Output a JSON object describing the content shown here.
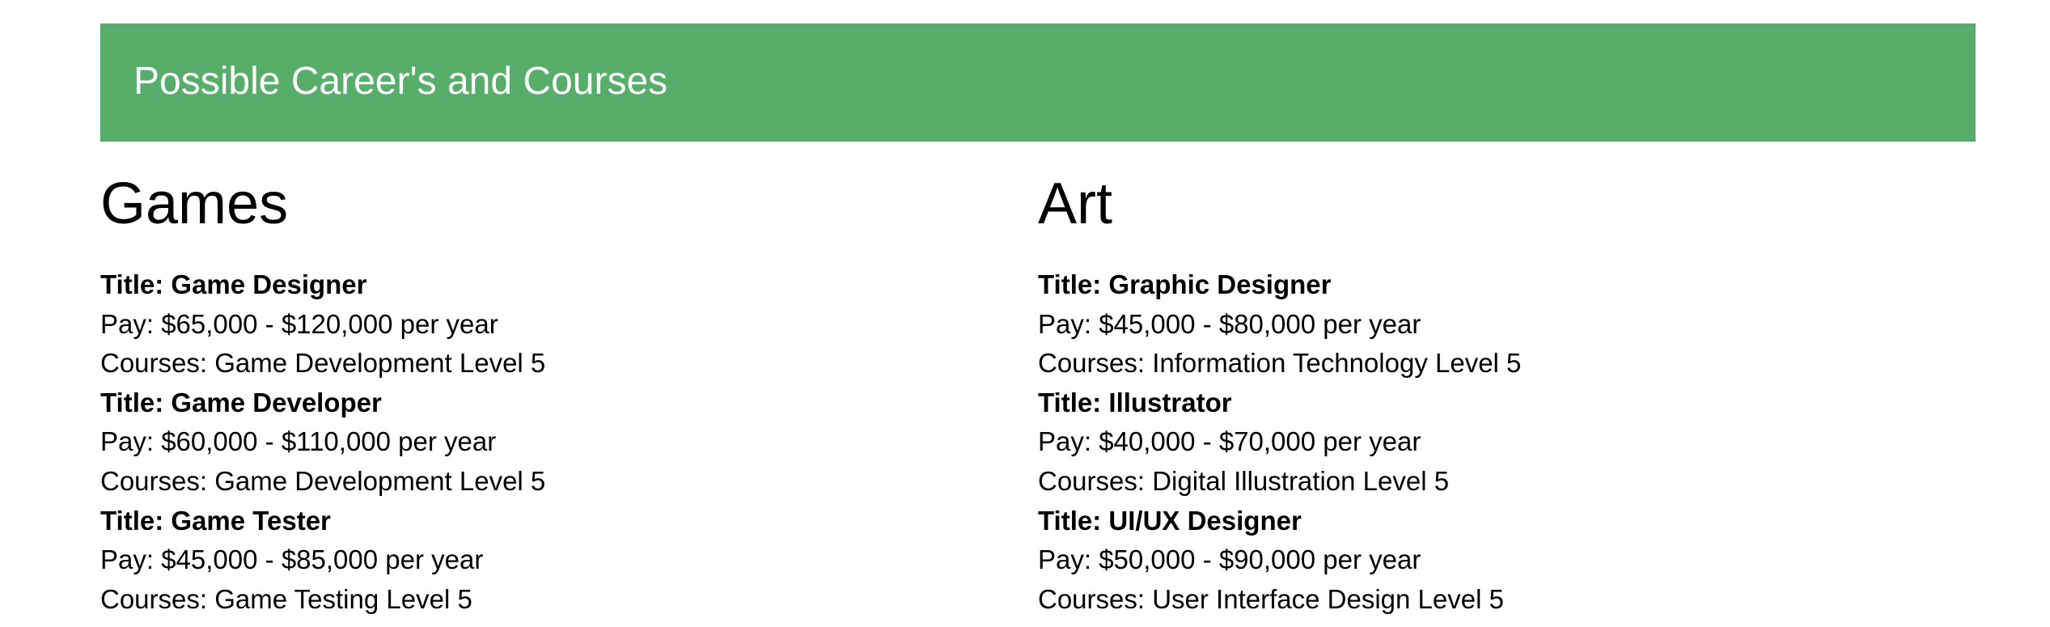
{
  "banner": {
    "title": "Possible Career's and Courses",
    "color": "#56ae6a"
  },
  "columns": [
    {
      "heading": "Games",
      "jobs": [
        {
          "title": "Title: Game Designer",
          "pay": "Pay: $65,000 - $120,000 per year",
          "courses": "Courses: Game Development Level 5"
        },
        {
          "title": "Title: Game Developer",
          "pay": "Pay: $60,000 - $110,000 per year",
          "courses": "Courses: Game Development Level 5"
        },
        {
          "title": "Title: Game Tester",
          "pay": "Pay: $45,000 - $85,000 per year",
          "courses": "Courses: Game Testing Level 5"
        }
      ]
    },
    {
      "heading": "Art",
      "jobs": [
        {
          "title": "Title: Graphic Designer",
          "pay": "Pay: $45,000 - $80,000 per year",
          "courses": "Courses: Information Technology Level 5"
        },
        {
          "title": "Title: Illustrator",
          "pay": "Pay: $40,000 - $70,000 per year",
          "courses": "Courses: Digital Illustration Level 5"
        },
        {
          "title": "Title: UI/UX Designer",
          "pay": "Pay: $50,000 - $90,000 per year",
          "courses": "Courses: User Interface Design Level 5"
        }
      ]
    }
  ]
}
